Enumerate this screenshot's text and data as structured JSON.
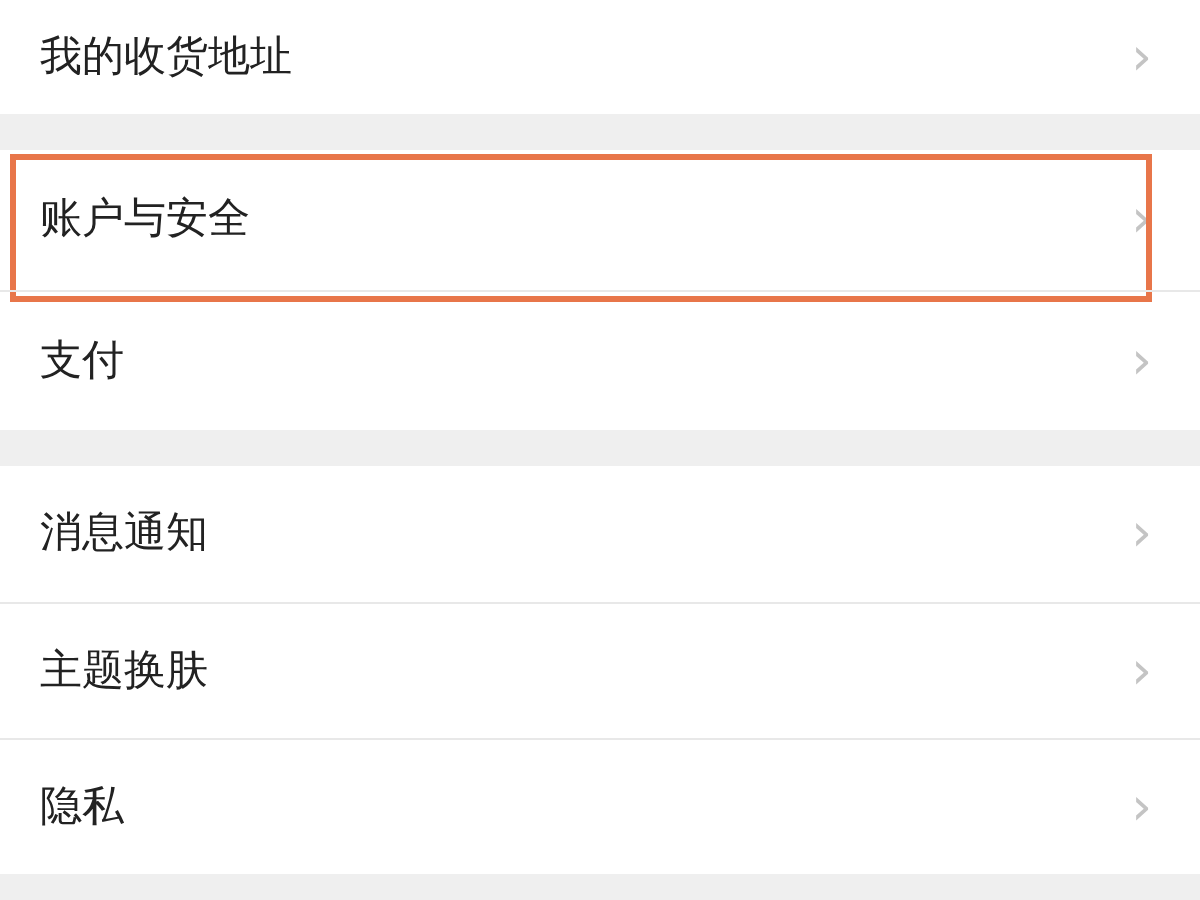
{
  "groups": [
    {
      "items": [
        {
          "label": "我的收货地址",
          "chevron": "›",
          "highlighted": false
        }
      ]
    },
    {
      "items": [
        {
          "label": "账户与安全",
          "chevron": "›",
          "highlighted": true
        },
        {
          "label": "支付",
          "chevron": "›",
          "highlighted": false
        }
      ]
    },
    {
      "items": [
        {
          "label": "消息通知",
          "chevron": "›",
          "highlighted": false
        },
        {
          "label": "主题换肤",
          "chevron": "›",
          "highlighted": false
        },
        {
          "label": "隐私",
          "chevron": "›",
          "highlighted": false
        }
      ]
    }
  ]
}
